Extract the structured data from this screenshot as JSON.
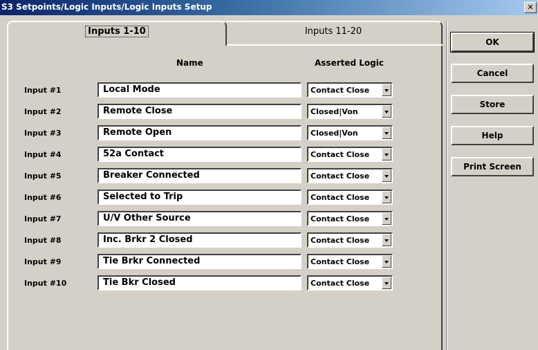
{
  "window": {
    "title": "S3 Setpoints/Logic Inputs/Logic Inputs Setup",
    "close_glyph": "✕"
  },
  "tabs": [
    {
      "label": "Inputs 1-10",
      "active": true
    },
    {
      "label": "Inputs 11-20",
      "active": false
    }
  ],
  "headers": {
    "name": "Name",
    "logic": "Asserted Logic"
  },
  "inputs": [
    {
      "label": "Input #1",
      "name": "Local Mode",
      "logic": "Contact Close"
    },
    {
      "label": "Input #2",
      "name": "Remote Close",
      "logic": "Closed|Von"
    },
    {
      "label": "Input #3",
      "name": "Remote Open",
      "logic": "Closed|Von"
    },
    {
      "label": "Input #4",
      "name": "52a Contact",
      "logic": "Contact Close"
    },
    {
      "label": "Input #5",
      "name": "Breaker Connected",
      "logic": "Contact Close"
    },
    {
      "label": "Input #6",
      "name": "Selected to Trip",
      "logic": "Contact Close"
    },
    {
      "label": "Input #7",
      "name": "U/V Other Source",
      "logic": "Contact Close"
    },
    {
      "label": "Input #8",
      "name": "Inc. Brkr 2 Closed",
      "logic": "Contact Close"
    },
    {
      "label": "Input #9",
      "name": "Tie Brkr Connected",
      "logic": "Contact Close"
    },
    {
      "label": "Input #10",
      "name": "Tie Bkr Closed",
      "logic": "Contact Close"
    }
  ],
  "buttons": {
    "ok": "OK",
    "cancel": "Cancel",
    "store": "Store",
    "help": "Help",
    "print": "Print Screen"
  }
}
